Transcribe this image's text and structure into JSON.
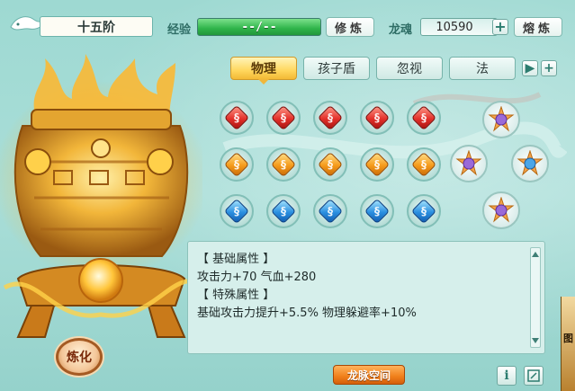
{
  "header": {
    "stage_title": "十五阶",
    "exp_label": "经验",
    "exp_value": "--/--",
    "cultivate_button": "修炼",
    "soul_label": "龙魂",
    "soul_value": "10590",
    "smelt_button": "熔炼"
  },
  "tabs": [
    {
      "label": "物理",
      "active": true
    },
    {
      "label": "孩子盾",
      "active": false
    },
    {
      "label": "忽视",
      "active": false
    },
    {
      "label": "法",
      "active": false
    }
  ],
  "gems": {
    "rows": [
      {
        "color": "red",
        "count": 5
      },
      {
        "color": "orange",
        "count": 5
      },
      {
        "color": "blue",
        "count": 5
      }
    ],
    "star_gems": 4
  },
  "cauldron": {
    "refine_button": "炼化"
  },
  "attributes": {
    "lines": [
      "【 基础属性 】",
      "攻击力+70  气血+280",
      "【 特殊属性 】",
      "基础攻击力提升+5.5%  物理躲避率+10%"
    ]
  },
  "footer": {
    "dragon_space_button": "龙脉空间",
    "edge_char": "图"
  },
  "colors": {
    "background": "#9ed9d2",
    "accent_gold": "#ffd75e",
    "exp_green": "#2fb44a",
    "orange_button": "#f07f1a"
  }
}
